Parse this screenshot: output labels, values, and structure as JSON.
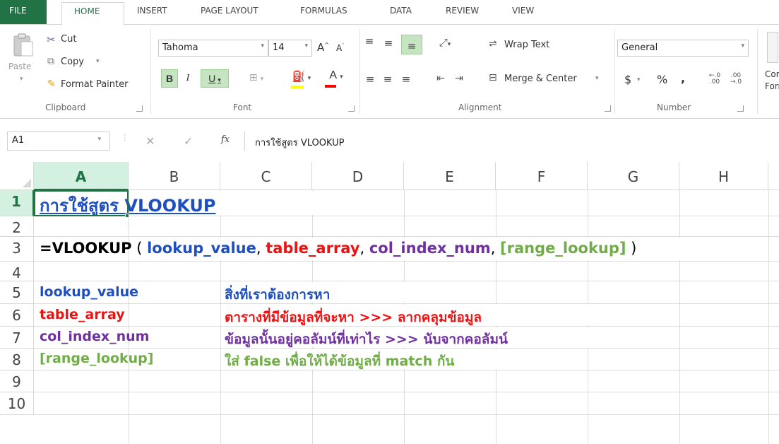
{
  "tabs": [
    "FILE",
    "HOME",
    "INSERT",
    "PAGE LAYOUT",
    "FORMULAS",
    "DATA",
    "REVIEW",
    "VIEW"
  ],
  "clipboard": {
    "paste": "Paste",
    "cut": "Cut",
    "copy": "Copy",
    "format_painter": "Format Painter",
    "label": "Clipboard"
  },
  "font": {
    "name": "Tahoma",
    "size": "14",
    "bold": "B",
    "italic": "I",
    "underline": "U",
    "label": "Font"
  },
  "alignment": {
    "wrap_text": "Wrap Text",
    "merge_center": "Merge & Center",
    "label": "Alignment"
  },
  "number": {
    "format": "General",
    "currency": "$",
    "percent": "%",
    "comma": ",",
    "label": "Number"
  },
  "styles": {
    "conditional_line1": "Cor",
    "conditional_line2": "Forr"
  },
  "formula_bar": {
    "name_box": "A1",
    "cancel": "✕",
    "enter": "✓",
    "fx": "fx",
    "value": "การใช้สูตร VLOOKUP"
  },
  "columns": [
    "A",
    "B",
    "C",
    "D",
    "E",
    "F",
    "G",
    "H"
  ],
  "rows": [
    "1",
    "2",
    "3",
    "4",
    "5",
    "6",
    "7",
    "8",
    "9",
    "10"
  ],
  "colors": {
    "accent": "#217346",
    "blue": "#1f4fbf",
    "red": "#ee1111",
    "purple": "#7030a0",
    "green": "#70ad47",
    "black": "#000000"
  },
  "cells": {
    "A1": "การใช้สูตร VLOOKUP",
    "A3_prefix": "=VLOOKUP",
    "A3_open": " ( ",
    "A3_lookup_value": "lookup_value",
    "A3_sep1": ", ",
    "A3_table_array": "table_array",
    "A3_sep2": ", ",
    "A3_col_index_num": "col_index_num",
    "A3_sep3": ", ",
    "A3_range_lookup": "[range_lookup]",
    "A3_close": " )",
    "A5": "lookup_value",
    "C5": "สิ่งที่เราต้องการหา",
    "A6": "table_array",
    "C6": "ตารางที่มีข้อมูลที่จะหา >>> ลากคลุมข้อมูล",
    "A7": "col_index_num",
    "C7": "ข้อมูลนั้นอยู่คอลัมน์ที่เท่าไร >>> นับจากคอลัมน์",
    "A8": "[range_lookup]",
    "C8": "ใส่ false เพื่อให้ได้ข้อมูลที่ match กัน"
  }
}
